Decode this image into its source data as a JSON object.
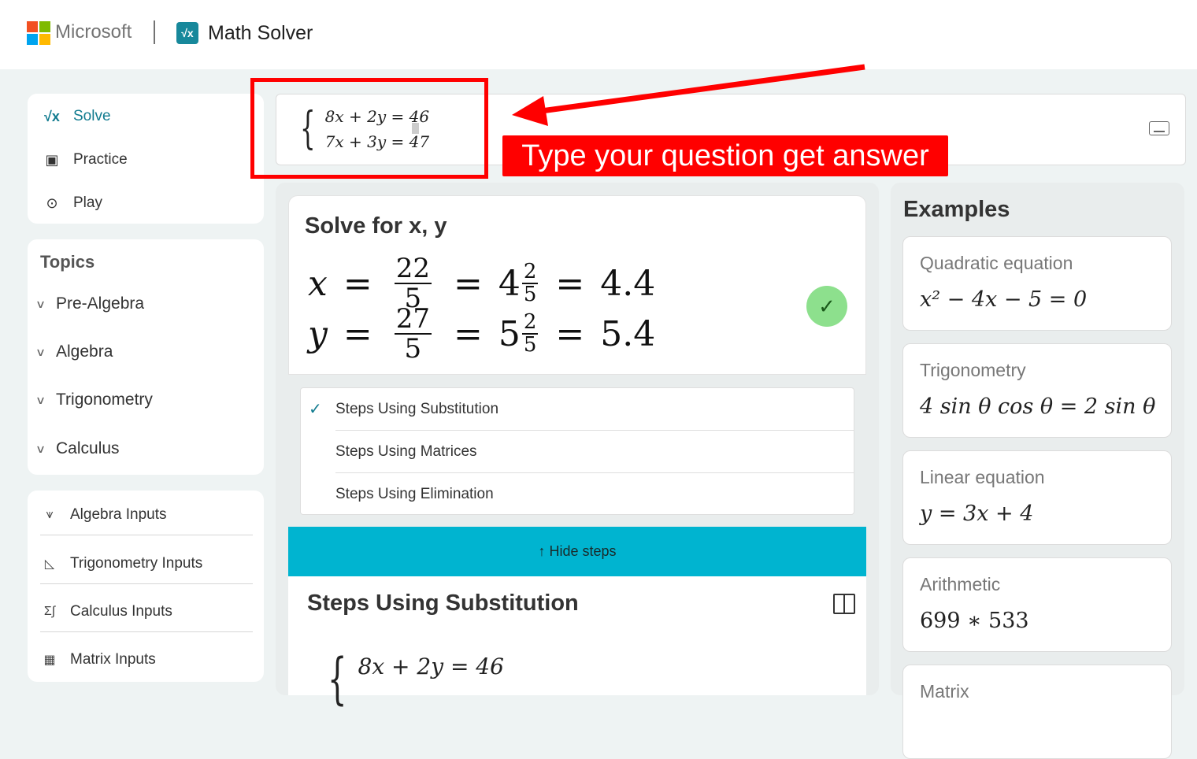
{
  "header": {
    "brand": "Microsoft",
    "app_icon": "√x",
    "app_title": "Math Solver"
  },
  "nav": {
    "items": [
      {
        "label": "Solve",
        "icon": "sqrt-icon"
      },
      {
        "label": "Practice",
        "icon": "practice-icon"
      },
      {
        "label": "Play",
        "icon": "gamepad-icon"
      }
    ]
  },
  "topics": {
    "title": "Topics",
    "items": [
      "Pre-Algebra",
      "Algebra",
      "Trigonometry",
      "Calculus"
    ]
  },
  "inputs": {
    "items": [
      "Algebra Inputs",
      "Trigonometry Inputs",
      "Calculus Inputs",
      "Matrix Inputs"
    ]
  },
  "question": {
    "line1": "8x + 2y = 46",
    "line2": "7x + 3y = 47"
  },
  "annotation": {
    "label": "Type your question get answer",
    "color": "#ff0000"
  },
  "solution": {
    "title": "Solve for x, y",
    "x": {
      "var": "x",
      "num": "22",
      "den": "5",
      "whole": "4",
      "mnum": "2",
      "mden": "5",
      "dec": "4.4"
    },
    "y": {
      "var": "y",
      "num": "27",
      "den": "5",
      "whole": "5",
      "mnum": "2",
      "mden": "5",
      "dec": "5.4"
    },
    "equals": "="
  },
  "methods": [
    "Steps Using Substitution",
    "Steps Using Matrices",
    "Steps Using Elimination"
  ],
  "hide_steps": "Hide steps",
  "steps": {
    "title": "Steps Using Substitution",
    "line1": "8x + 2y = 46"
  },
  "examples": {
    "title": "Examples",
    "items": [
      {
        "name": "Quadratic equation",
        "formula": "x² − 4x − 5 = 0"
      },
      {
        "name": "Trigonometry",
        "formula": "4 sin θ cos θ = 2 sin θ"
      },
      {
        "name": "Linear equation",
        "formula": "y = 3x + 4"
      },
      {
        "name": "Arithmetic",
        "formula": "699 ∗ 533"
      },
      {
        "name": "Matrix",
        "formula": ""
      }
    ]
  },
  "colors": {
    "accent": "#117b8f",
    "hide_steps_bg": "#00b4d0",
    "success": "#8de08d"
  }
}
